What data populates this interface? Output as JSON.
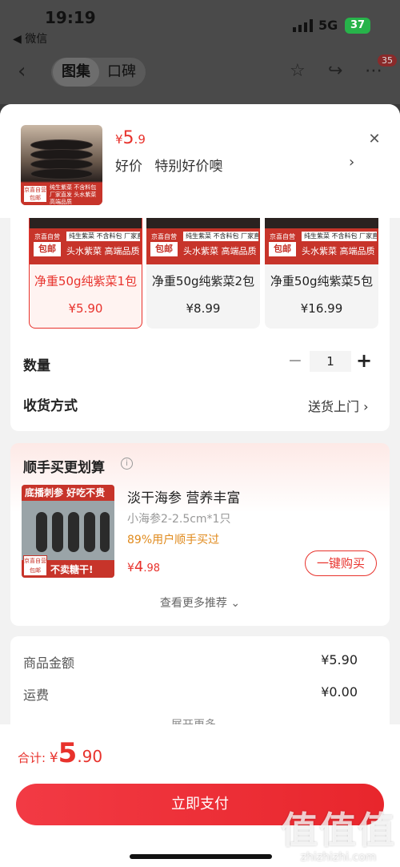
{
  "status": {
    "time": "19:19",
    "back_app": "◀ 微信",
    "network": "5G",
    "battery": "37"
  },
  "bg_nav": {
    "tabs": [
      "图集",
      "口碑"
    ],
    "badge": "35"
  },
  "sku_header": {
    "price_symbol": "¥",
    "price_int": "5",
    "price_dec": ".9",
    "promo_tags": [
      "好价",
      "特别好价噢"
    ],
    "thumb_text": "纯生紫菜 不含料包 厂家直发 头水紫菜 高端品质",
    "thumb_tag": "京喜自营 包邮"
  },
  "options": [
    {
      "img_tag_top": "京喜自营",
      "img_tag_bottom": "包邮",
      "img_line1": "纯生紫菜 不含料包 厂家直发",
      "img_line2": "头水紫菜 高端品质",
      "name": "净重50g纯紫菜1包",
      "price": "¥5.90",
      "selected": true
    },
    {
      "img_tag_top": "京喜自营",
      "img_tag_bottom": "包邮",
      "img_line1": "纯生紫菜 不含料包 厂家直发",
      "img_line2": "头水紫菜 高端品质",
      "name": "净重50g纯紫菜2包",
      "price": "¥8.99",
      "selected": false
    },
    {
      "img_tag_top": "京喜自营",
      "img_tag_bottom": "包邮",
      "img_line1": "纯生紫菜 不含料包 厂家直发",
      "img_line2": "头水紫菜 高端品质",
      "name": "净重50g纯紫菜5包",
      "price": "¥16.99",
      "selected": false
    }
  ],
  "quantity": {
    "label": "数量",
    "minus": "−",
    "value": "1",
    "plus": "+"
  },
  "shipping": {
    "label": "收货方式",
    "value": "送货上门 ›"
  },
  "recommend": {
    "title": "顺手买更划算",
    "img_top": "底播刺参 好吃不贵",
    "img_tag": "京喜自营 包邮",
    "img_slogan": "不卖糖干!",
    "name": "淡干海参 营养丰富",
    "spec": "小海参2-2.5cm*1只",
    "bought": "89%用户顺手买过",
    "price_symbol": "¥",
    "price_int": "4",
    "price_dec": ".98",
    "buy_label": "一键购买",
    "more_label": "查看更多推荐 ⌄"
  },
  "fees": {
    "goods_label": "商品金额",
    "goods_value": "¥5.90",
    "shipping_label": "运费",
    "shipping_value": "¥0.00",
    "expand_label": "展开更多 ⌄"
  },
  "footer": {
    "total_label": "合计: ",
    "total_symbol": "¥",
    "total_int": "5",
    "total_dec": ".90",
    "pay_label": "立即支付"
  },
  "watermark": {
    "big": "值值值",
    "small": "zhizhizhi.com"
  },
  "colors": {
    "accent": "#e8322c",
    "bought": "#e08a1c",
    "battery": "#27b34a"
  }
}
